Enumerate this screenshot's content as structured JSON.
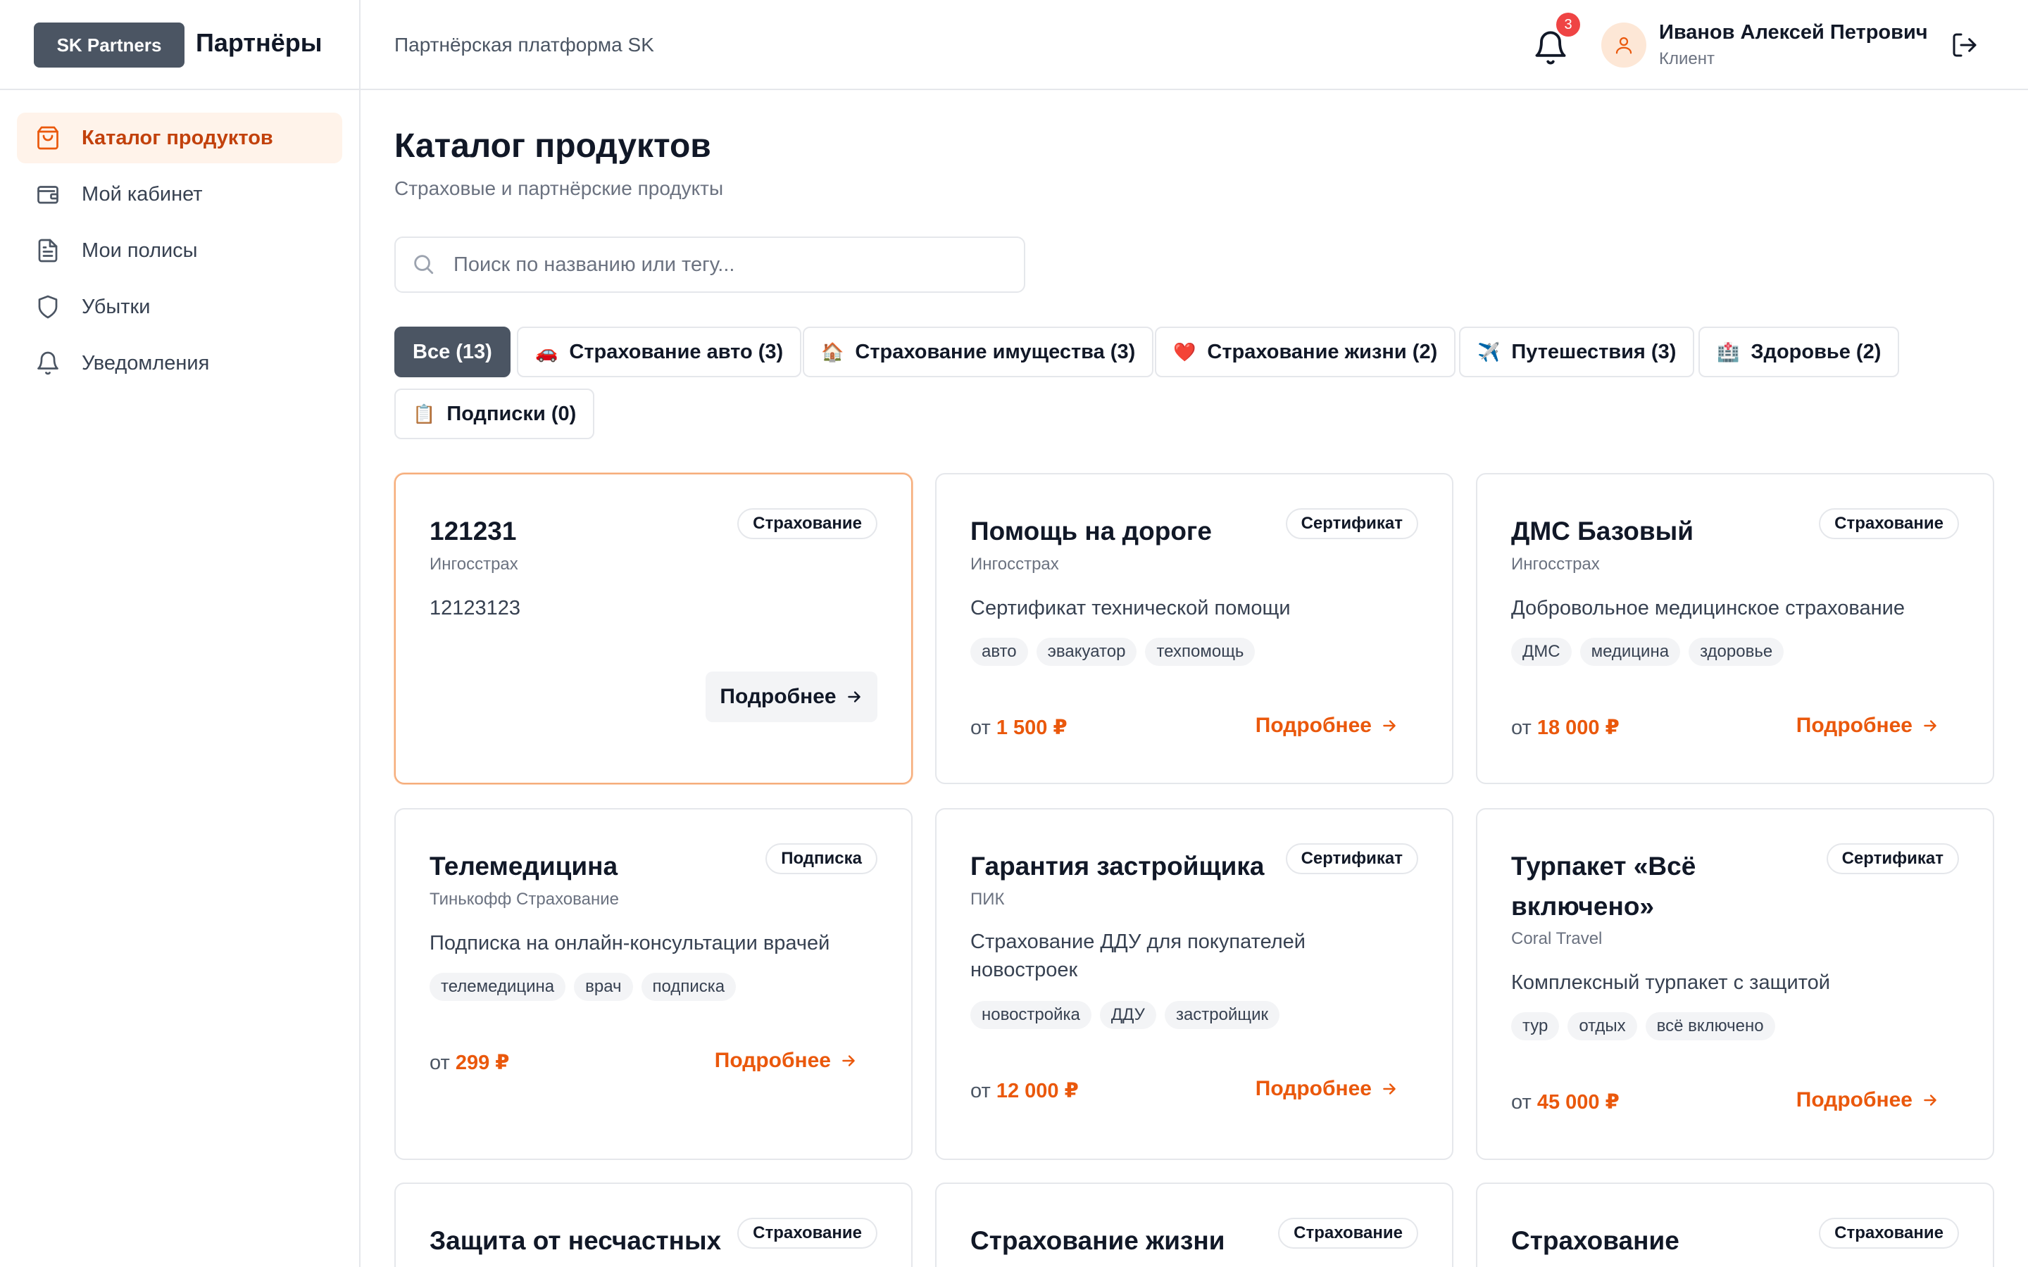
{
  "header": {
    "logo_badge": "SK Partners",
    "logo_text": "Партнёры",
    "platform_title": "Партнёрская платформа SK",
    "notifications_count": "3",
    "user_name": "Иванов Алексей Петрович",
    "user_role": "Клиент"
  },
  "sidebar": {
    "items": [
      {
        "label": "Каталог продуктов",
        "icon": "shopping-bag-icon",
        "active": true
      },
      {
        "label": "Мой кабинет",
        "icon": "wallet-icon",
        "active": false
      },
      {
        "label": "Мои полисы",
        "icon": "document-icon",
        "active": false
      },
      {
        "label": "Убытки",
        "icon": "shield-icon",
        "active": false
      },
      {
        "label": "Уведомления",
        "icon": "bell-icon",
        "active": false
      }
    ]
  },
  "main": {
    "title": "Каталог продуктов",
    "subtitle": "Страховые и партнёрские продукты",
    "search": {
      "placeholder": "Поиск по названию или тегу...",
      "value": ""
    },
    "categories": [
      {
        "label": "Все (13)",
        "emoji": "",
        "active": true
      },
      {
        "label": "Страхование авто (3)",
        "emoji": "🚗"
      },
      {
        "label": "Страхование имущества (3)",
        "emoji": "🏠"
      },
      {
        "label": "Страхование жизни (2)",
        "emoji": "❤️"
      },
      {
        "label": "Путешествия (3)",
        "emoji": "✈️"
      },
      {
        "label": "Здоровье (2)",
        "emoji": "🏥"
      },
      {
        "label": "Подписки (0)",
        "emoji": "📋"
      }
    ],
    "price_prefix": "от",
    "more_label": "Подробнее",
    "products": [
      {
        "title": "121231",
        "badge": "Страхование",
        "company": "Ингосстрах",
        "description": "12123123",
        "tags": [],
        "price": ""
      },
      {
        "title": "Помощь на дороге",
        "badge": "Сертификат",
        "company": "Ингосстрах",
        "description": "Сертификат технической помощи",
        "tags": [
          "авто",
          "эвакуатор",
          "техпомощь"
        ],
        "price": "1 500 ₽"
      },
      {
        "title": "ДМС Базовый",
        "badge": "Страхование",
        "company": "Ингосстрах",
        "description": "Добровольное медицинское страхование",
        "tags": [
          "ДМС",
          "медицина",
          "здоровье"
        ],
        "price": "18 000 ₽"
      },
      {
        "title": "Телемедицина",
        "badge": "Подписка",
        "company": "Тинькофф Страхование",
        "description": "Подписка на онлайн-консультации врачей",
        "tags": [
          "телемедицина",
          "врач",
          "подписка"
        ],
        "price": "299 ₽"
      },
      {
        "title": "Гарантия застройщика",
        "badge": "Сертификат",
        "company": "ПИК",
        "description": "Страхование ДДУ для покупателей новостроек",
        "tags": [
          "новостройка",
          "ДДУ",
          "застройщик"
        ],
        "price": "12 000 ₽"
      },
      {
        "title": "Турпакет «Всё включено»",
        "badge": "Сертификат",
        "company": "Coral Travel",
        "description": "Комплексный турпакет с защитой",
        "tags": [
          "тур",
          "отдых",
          "всё включено"
        ],
        "price": "45 000 ₽"
      },
      {
        "title": "Защита от несчастных",
        "badge": "Страхование"
      },
      {
        "title": "Страхование жизни",
        "badge": "Страхование"
      },
      {
        "title": "Страхование",
        "badge": "Страхование"
      }
    ]
  }
}
